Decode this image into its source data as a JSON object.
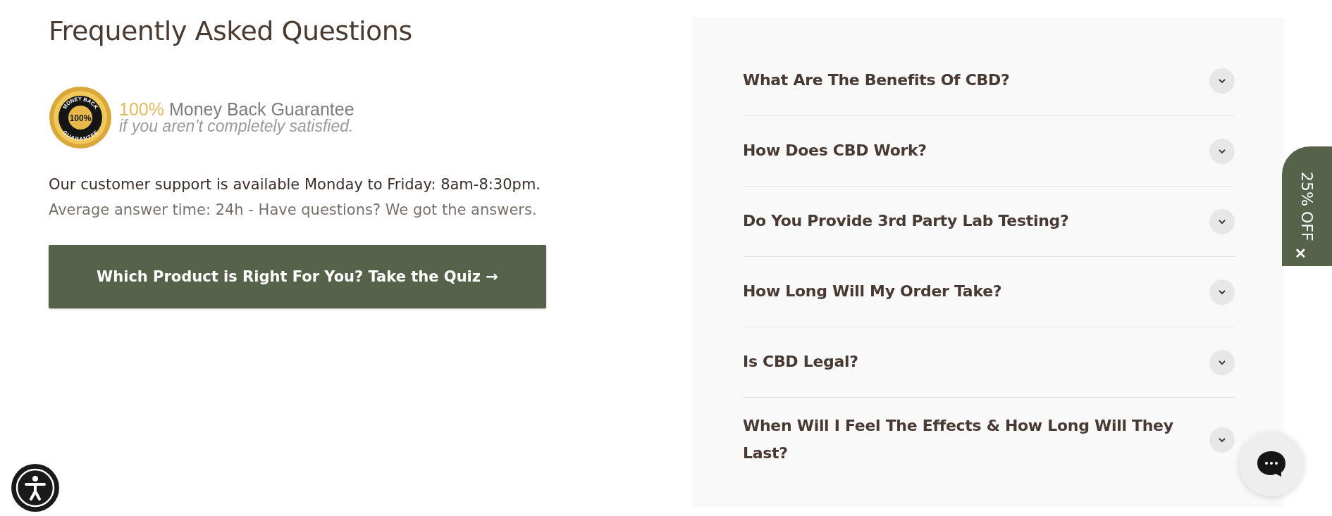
{
  "heading": "Frequently Asked Questions",
  "guarantee": {
    "seal": {
      "top": "MONEY BACK",
      "center": "100%",
      "bottom": "GUARANTEE"
    },
    "highlight": "100%",
    "title": "Money Back Guarantee",
    "subtitle": "if you aren’t completely satisfied."
  },
  "support_text": "Our customer support is available Monday to Friday: 8am-8:30pm.",
  "answer_text": "Average answer time: 24h - Have questions? We got the answers.",
  "quiz_button": "Which Product is Right For You? Take the Quiz →",
  "faq": [
    {
      "question": "What Are The Benefits Of CBD?",
      "expanded": false
    },
    {
      "question": "How Does CBD Work?",
      "expanded": false
    },
    {
      "question": "Do You Provide 3rd Party Lab Testing?",
      "expanded": false
    },
    {
      "question": "How Long Will My Order Take?",
      "expanded": false
    },
    {
      "question": "Is CBD Legal?",
      "expanded": false
    },
    {
      "question": "When Will I Feel The Effects & How Long Will They Last?",
      "expanded": false
    }
  ],
  "discount_tab": {
    "label": "25% OFF",
    "close": "✕"
  }
}
